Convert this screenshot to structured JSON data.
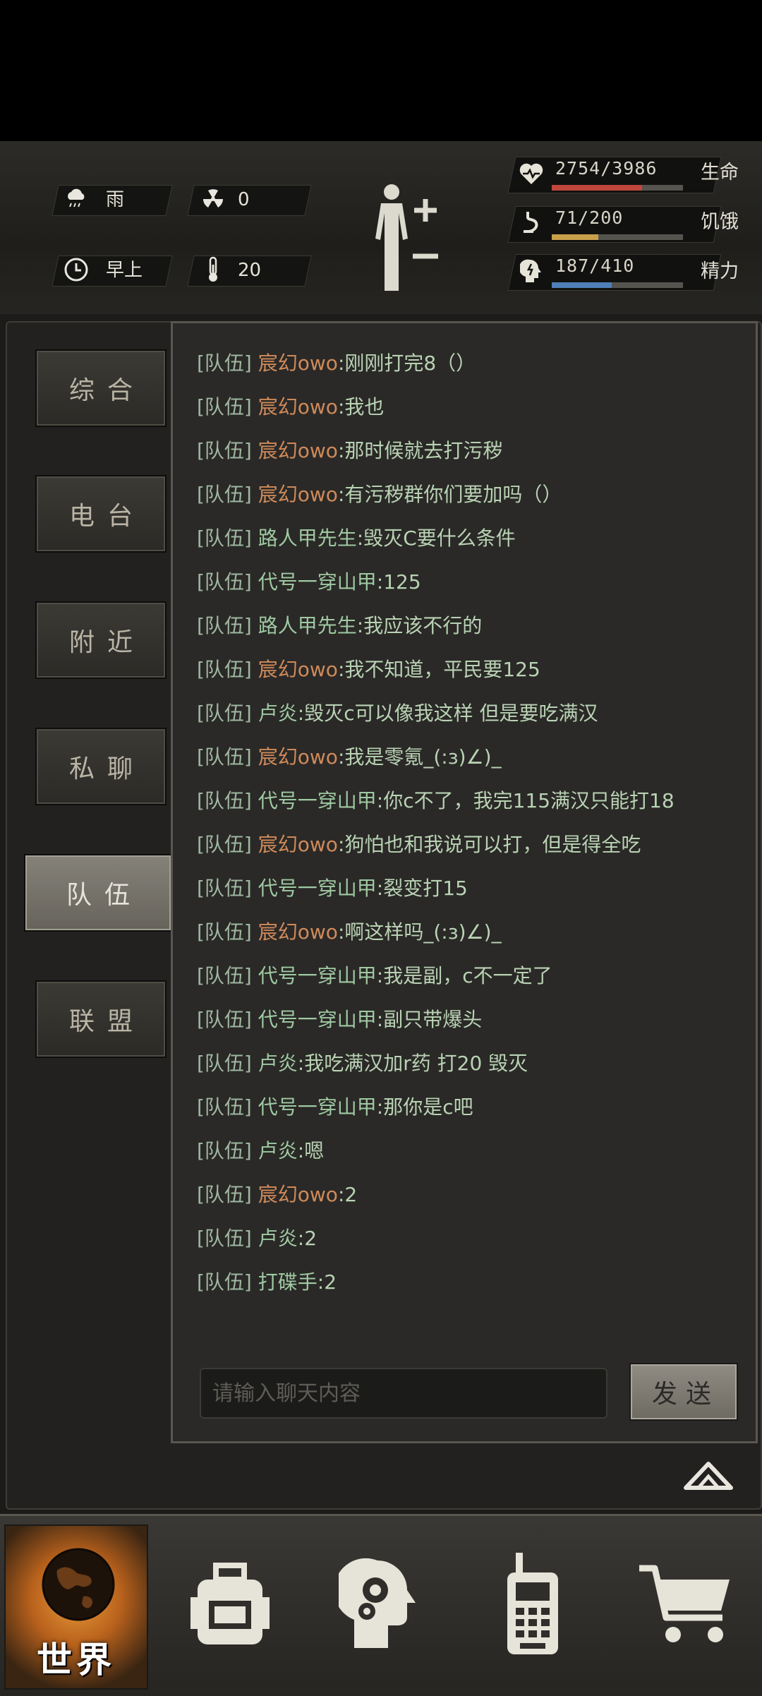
{
  "status": {
    "weather": {
      "icon": "rain-cloud-icon",
      "label": "雨"
    },
    "radiation": {
      "icon": "radiation-icon",
      "value": "0"
    },
    "time": {
      "icon": "clock-icon",
      "label": "早上"
    },
    "temperature": {
      "icon": "thermometer-icon",
      "value": "20"
    },
    "body": {
      "icon": "body-figure-icon",
      "zoom_in": "plus-icon",
      "zoom_out": "minus-icon"
    },
    "health": {
      "value": "2754/3986",
      "label": "生命",
      "fraction": 0.69,
      "color": "#c0463c"
    },
    "hunger": {
      "value": "71/200",
      "label": "饥饿",
      "fraction": 0.355,
      "color": "#c8a04a"
    },
    "energy": {
      "value": "187/410",
      "label": "精力",
      "fraction": 0.456,
      "color": "#4f7fb8"
    }
  },
  "tabs": [
    {
      "label": "综合",
      "active": false
    },
    {
      "label": "电台",
      "active": false
    },
    {
      "label": "附近",
      "active": false
    },
    {
      "label": "私聊",
      "active": false
    },
    {
      "label": "队伍",
      "active": true
    },
    {
      "label": "联盟",
      "active": false
    }
  ],
  "chat": {
    "messages": [
      {
        "channel": "[队伍]",
        "name": "宸幻owo",
        "text": ":刚刚打完8（）",
        "highlight": true
      },
      {
        "channel": "[队伍]",
        "name": "宸幻owo",
        "text": ":我也",
        "highlight": true
      },
      {
        "channel": "[队伍]",
        "name": "宸幻owo",
        "text": ":那时候就去打污秽",
        "highlight": true
      },
      {
        "channel": "[队伍]",
        "name": "宸幻owo",
        "text": ":有污秽群你们要加吗（）",
        "highlight": true
      },
      {
        "channel": "[队伍]",
        "name": "路人甲先生",
        "text": ":毁灭C要什么条件",
        "highlight": false
      },
      {
        "channel": "[队伍]",
        "name": "代号一穿山甲",
        "text": ":125",
        "highlight": false
      },
      {
        "channel": "[队伍]",
        "name": "路人甲先生",
        "text": ":我应该不行的",
        "highlight": false
      },
      {
        "channel": "[队伍]",
        "name": "宸幻owo",
        "text": ":我不知道，平民要125",
        "highlight": true
      },
      {
        "channel": "[队伍]",
        "name": "卢炎",
        "text": ":毁灭c可以像我这样 但是要吃满汉",
        "highlight": false
      },
      {
        "channel": "[队伍]",
        "name": "宸幻owo",
        "text": ":我是零氪_(:з)∠)_",
        "highlight": true
      },
      {
        "channel": "[队伍]",
        "name": "代号一穿山甲",
        "text": ":你c不了，我完115满汉只能打18",
        "highlight": false
      },
      {
        "channel": "[队伍]",
        "name": "宸幻owo",
        "text": ":狗怕也和我说可以打，但是得全吃",
        "highlight": true
      },
      {
        "channel": "[队伍]",
        "name": "代号一穿山甲",
        "text": ":裂变打15",
        "highlight": false
      },
      {
        "channel": "[队伍]",
        "name": "宸幻owo",
        "text": ":啊这样吗_(:з)∠)_",
        "highlight": true
      },
      {
        "channel": "[队伍]",
        "name": "代号一穿山甲",
        "text": ":我是副，c不一定了",
        "highlight": false
      },
      {
        "channel": "[队伍]",
        "name": "代号一穿山甲",
        "text": ":副只带爆头",
        "highlight": false
      },
      {
        "channel": "[队伍]",
        "name": "卢炎",
        "text": ":我吃满汉加r药 打20 毁灭",
        "highlight": false
      },
      {
        "channel": "[队伍]",
        "name": "代号一穿山甲",
        "text": ":那你是c吧",
        "highlight": false
      },
      {
        "channel": "[队伍]",
        "name": "卢炎",
        "text": ":嗯",
        "highlight": false
      },
      {
        "channel": "[队伍]",
        "name": "宸幻owo",
        "text": ":2",
        "highlight": true
      },
      {
        "channel": "[队伍]",
        "name": "卢炎",
        "text": ":2",
        "highlight": false
      },
      {
        "channel": "[队伍]",
        "name": "打碟手",
        "text": ":2",
        "highlight": false
      }
    ],
    "input_placeholder": "请输入聊天内容",
    "send_label": "发送"
  },
  "nav": {
    "world_label": "世界",
    "items": [
      "globe-icon",
      "backpack-icon",
      "head-gear-icon",
      "walkie-talkie-icon",
      "shopping-cart-icon"
    ]
  }
}
